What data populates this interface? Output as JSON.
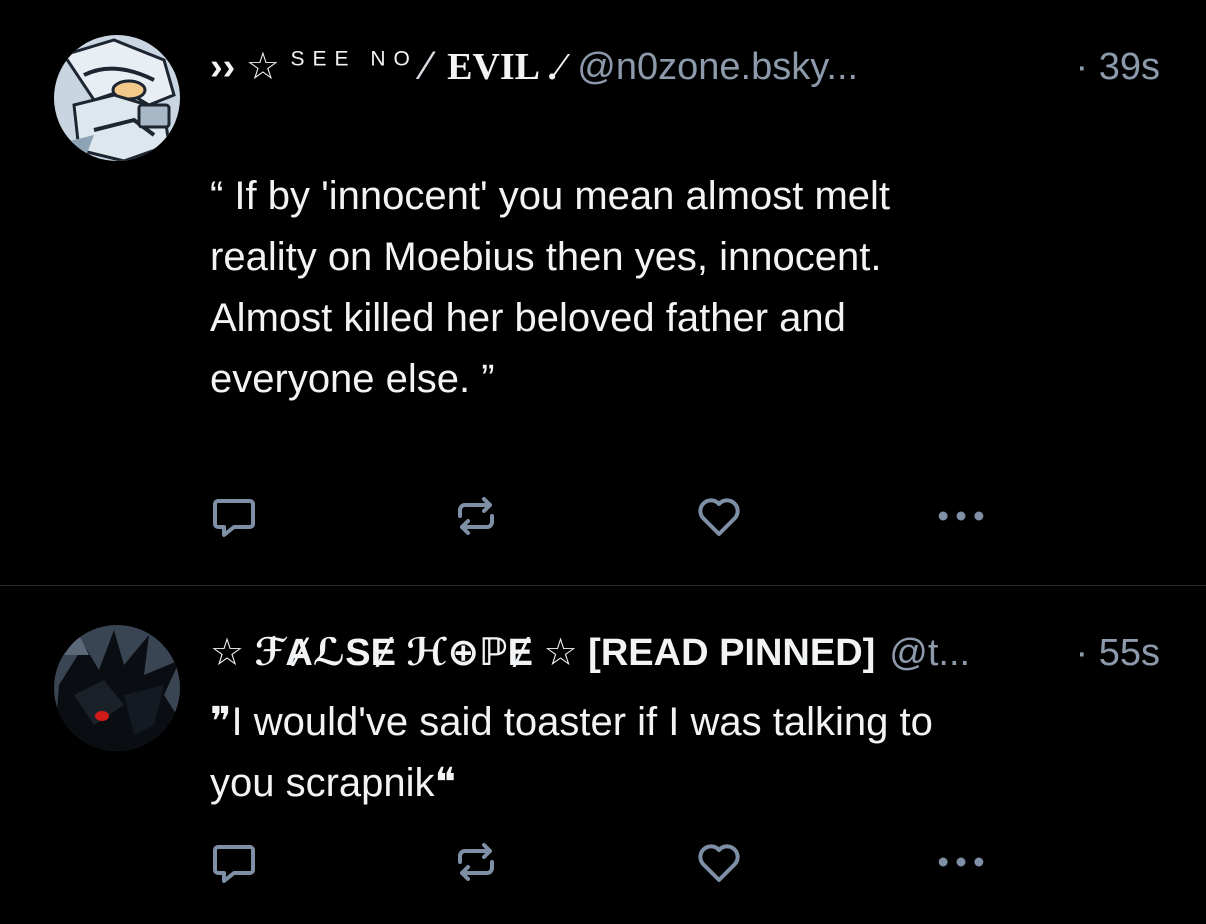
{
  "posts": [
    {
      "display_name": {
        "prefix": "›› ☆ ",
        "see_no": "SEE NO",
        "slash": "⁄",
        "evil": "EVIL .⁄"
      },
      "handle": "@n0zone.bsky...",
      "time": "· 39s",
      "text": "“ If by 'innocent' you mean almost melt\nreality on Moebius then yes, innocent.\nAlmost killed her beloved father and\neveryone else. ”",
      "avatar_icon": "anime-character-avatar"
    },
    {
      "display_name": {
        "full": "☆ ℱȺℒЅɆ ℋ⊕ℙɆ ☆ [READ PINNED]"
      },
      "handle": "@t...",
      "time": "· 55s",
      "text": "❞I would've said toaster if I was talking to\nyou scrapnik❝",
      "avatar_icon": "dark-hedgehog-avatar"
    }
  ],
  "icons": {
    "reply": "reply-icon",
    "repost": "repost-icon",
    "like": "heart-icon",
    "more": "more-icon"
  },
  "colors": {
    "background": "#000000",
    "text": "#f1f3f5",
    "muted": "#8c9aab",
    "icon": "#7f8fa6",
    "divider": "#2a2f36"
  }
}
